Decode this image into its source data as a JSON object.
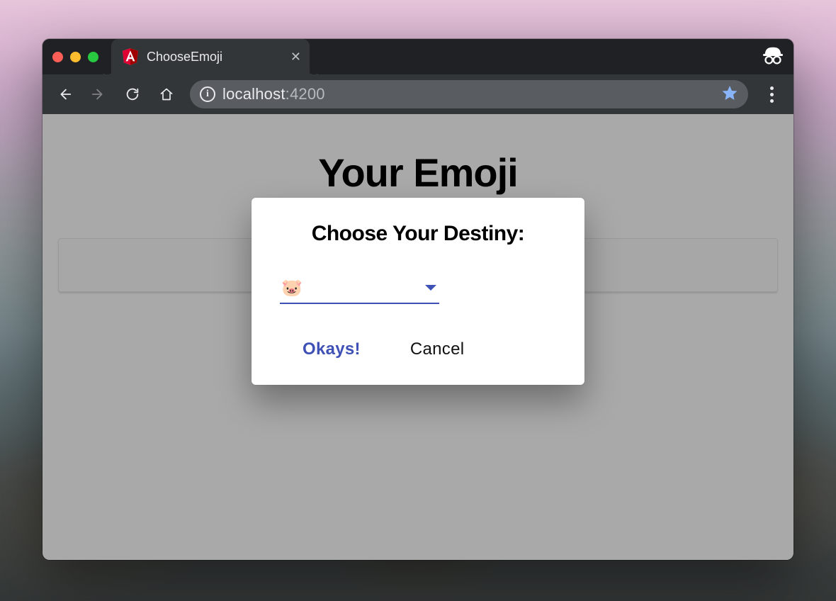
{
  "browser": {
    "tab_title": "ChooseEmoji",
    "favicon": "angular",
    "url_host": "localhost",
    "url_port": ":4200",
    "incognito": true
  },
  "page": {
    "heading": "Your Emoji"
  },
  "dialog": {
    "title": "Choose Your Destiny:",
    "select_value": "🐷",
    "ok_label": "Okays!",
    "cancel_label": "Cancel"
  },
  "colors": {
    "accent": "#3f51b5",
    "star": "#8ab4f8"
  }
}
